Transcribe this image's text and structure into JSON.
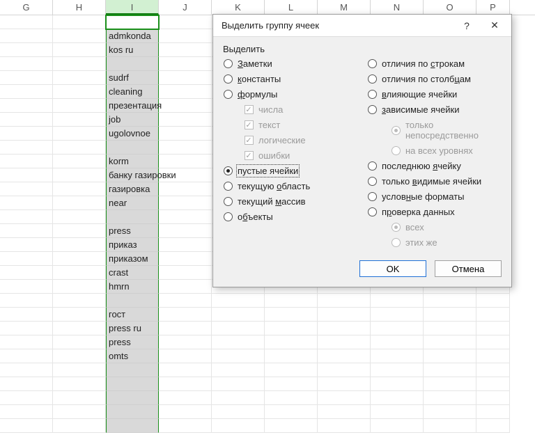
{
  "columns": [
    {
      "id": "G",
      "label": "G",
      "width": 76
    },
    {
      "id": "H",
      "label": "H",
      "width": 76
    },
    {
      "id": "I",
      "label": "I",
      "width": 76,
      "selected": true
    },
    {
      "id": "J",
      "label": "J",
      "width": 76
    },
    {
      "id": "K",
      "label": "K",
      "width": 76
    },
    {
      "id": "L",
      "label": "L",
      "width": 76
    },
    {
      "id": "M",
      "label": "M",
      "width": 76
    },
    {
      "id": "N",
      "label": "N",
      "width": 76
    },
    {
      "id": "O",
      "label": "O",
      "width": 76
    },
    {
      "id": "P",
      "label": "P",
      "width": 48
    }
  ],
  "selected_column": "I",
  "active_cell_row": 0,
  "column_i_values": [
    "",
    "admkonda",
    "kos ru",
    "",
    "sudrf",
    "cleaning",
    "презентация",
    "job",
    "ugolovnoe",
    "",
    "korm",
    "банку газировки",
    "газировка",
    "near",
    "",
    "press",
    "приказ",
    "приказом",
    "crast",
    "hmrn",
    "",
    "гост",
    "press ru",
    "press",
    "omts",
    "",
    "",
    "",
    "",
    ""
  ],
  "dialog": {
    "title": "Выделить группу ячеек",
    "help_symbol": "?",
    "close_symbol": "✕",
    "group_label": "Выделить",
    "left_options": [
      {
        "id": "notes",
        "label": "Заметки",
        "underline": "З",
        "checked": false
      },
      {
        "id": "constants",
        "label": "константы",
        "underline": "к",
        "checked": false
      },
      {
        "id": "formulas",
        "label": "формулы",
        "underline": "ф",
        "checked": false
      },
      {
        "id": "blanks",
        "label": "пустые ячейки",
        "underline": "",
        "checked": true,
        "focused": true
      },
      {
        "id": "cur-region",
        "label": "текущую область",
        "underline": "о",
        "checked": false
      },
      {
        "id": "cur-array",
        "label": "текущий массив",
        "underline": "м",
        "checked": false
      },
      {
        "id": "objects",
        "label": "объекты",
        "underline": "б",
        "checked": false
      }
    ],
    "formula_subs": [
      {
        "id": "numbers",
        "label": "числа",
        "checked": true
      },
      {
        "id": "text",
        "label": "текст",
        "checked": true
      },
      {
        "id": "logic",
        "label": "логические",
        "checked": true
      },
      {
        "id": "errors",
        "label": "ошибки",
        "checked": true
      }
    ],
    "right_options": [
      {
        "id": "row-diff",
        "label": "отличия по строкам",
        "underline": "с",
        "checked": false
      },
      {
        "id": "col-diff",
        "label": "отличия по столбцам",
        "underline": "ц",
        "checked": false
      },
      {
        "id": "precedents",
        "label": "влияющие ячейки",
        "underline": "в",
        "checked": false
      },
      {
        "id": "dependents",
        "label": "зависимые ячейки",
        "underline": "з",
        "checked": false
      },
      {
        "id": "last-cell",
        "label": "последнюю ячейку",
        "underline": "я",
        "checked": false
      },
      {
        "id": "visible",
        "label": "только видимые ячейки",
        "underline": "в",
        "checked": false
      },
      {
        "id": "cond-fmt",
        "label": "условные форматы",
        "underline": "н",
        "checked": false
      },
      {
        "id": "validation",
        "label": "проверка данных",
        "underline": "р",
        "checked": false
      }
    ],
    "dep_subs": [
      {
        "id": "direct",
        "label": "только непосредственно",
        "checked": true
      },
      {
        "id": "all",
        "label": "на всех уровнях",
        "checked": false
      }
    ],
    "val_subs": [
      {
        "id": "all-v",
        "label": "всех",
        "checked": true
      },
      {
        "id": "same-v",
        "label": "этих же",
        "checked": false
      }
    ],
    "buttons": {
      "ok": "OK",
      "cancel": "Отмена"
    }
  }
}
